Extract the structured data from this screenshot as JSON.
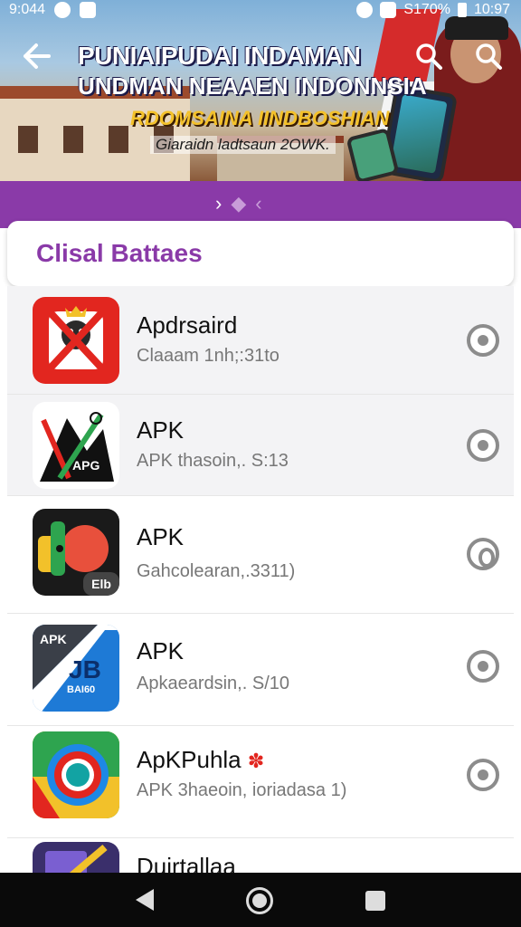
{
  "status_bar": {
    "time_left": "9:044",
    "battery": "S170%",
    "time_right": "10:97"
  },
  "header": {
    "headline_1": "PUNIAIPUDAI INDAMAN",
    "headline_2": "UNDMAN NEAAEN INDONNSIA",
    "headline_3": "RDOMSAINA IINDBOSHIAN",
    "headline_4": "Giaraidn ladtsaun 2OWK."
  },
  "pager": {
    "next": "›",
    "current": "◆",
    "prev": "‹"
  },
  "section": {
    "title": "Clisal Battaes"
  },
  "apps": [
    {
      "title": "Apdrsaird",
      "subtitle": "Claaam  1nh;:31to",
      "icon": "crossed-app-icon"
    },
    {
      "title": "APK",
      "subtitle": "APK thasoin,. S:13",
      "icon": "apk-chart-icon",
      "icon_badge": "APG"
    },
    {
      "title": "APK",
      "subtitle": "Gahcolearan,.3311)",
      "icon": "paint-app-icon",
      "icon_badge": "Elb"
    },
    {
      "title": "APK",
      "subtitle": "Apkaeardsin,. S/10",
      "icon": "jb-app-icon",
      "icon_label_top": "APK",
      "icon_label_main": "JB",
      "icon_label_bottom": "BAI60"
    },
    {
      "title": "ApKPuhla",
      "subtitle": "APK 3haeoin, ioriadasa 1)",
      "icon": "circle-app-icon",
      "title_badge": "✽"
    },
    {
      "title": "Duirtallaa",
      "subtitle": "",
      "icon": "partial-app-icon"
    }
  ],
  "colors": {
    "accent_purple": "#8a3aa8",
    "text_primary": "#111111",
    "text_secondary": "#777777"
  }
}
